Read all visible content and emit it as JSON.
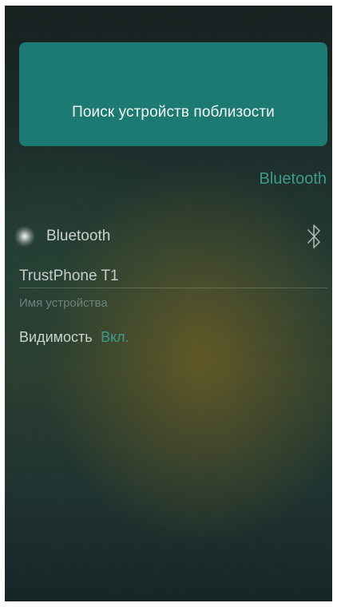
{
  "search": {
    "label": "Поиск устройств поблизости"
  },
  "section": {
    "title": "Bluetooth"
  },
  "bluetooth": {
    "label": "Bluetooth",
    "icon": "bluetooth-icon"
  },
  "device": {
    "name": "TrustPhone T1",
    "caption": "Имя устройства"
  },
  "visibility": {
    "label": "Видимость",
    "value": "Вкл."
  },
  "colors": {
    "accent": "#3f9a8e",
    "card": "#1d7a72",
    "text_primary": "#c9d3cf",
    "text_secondary": "#6f807b"
  }
}
